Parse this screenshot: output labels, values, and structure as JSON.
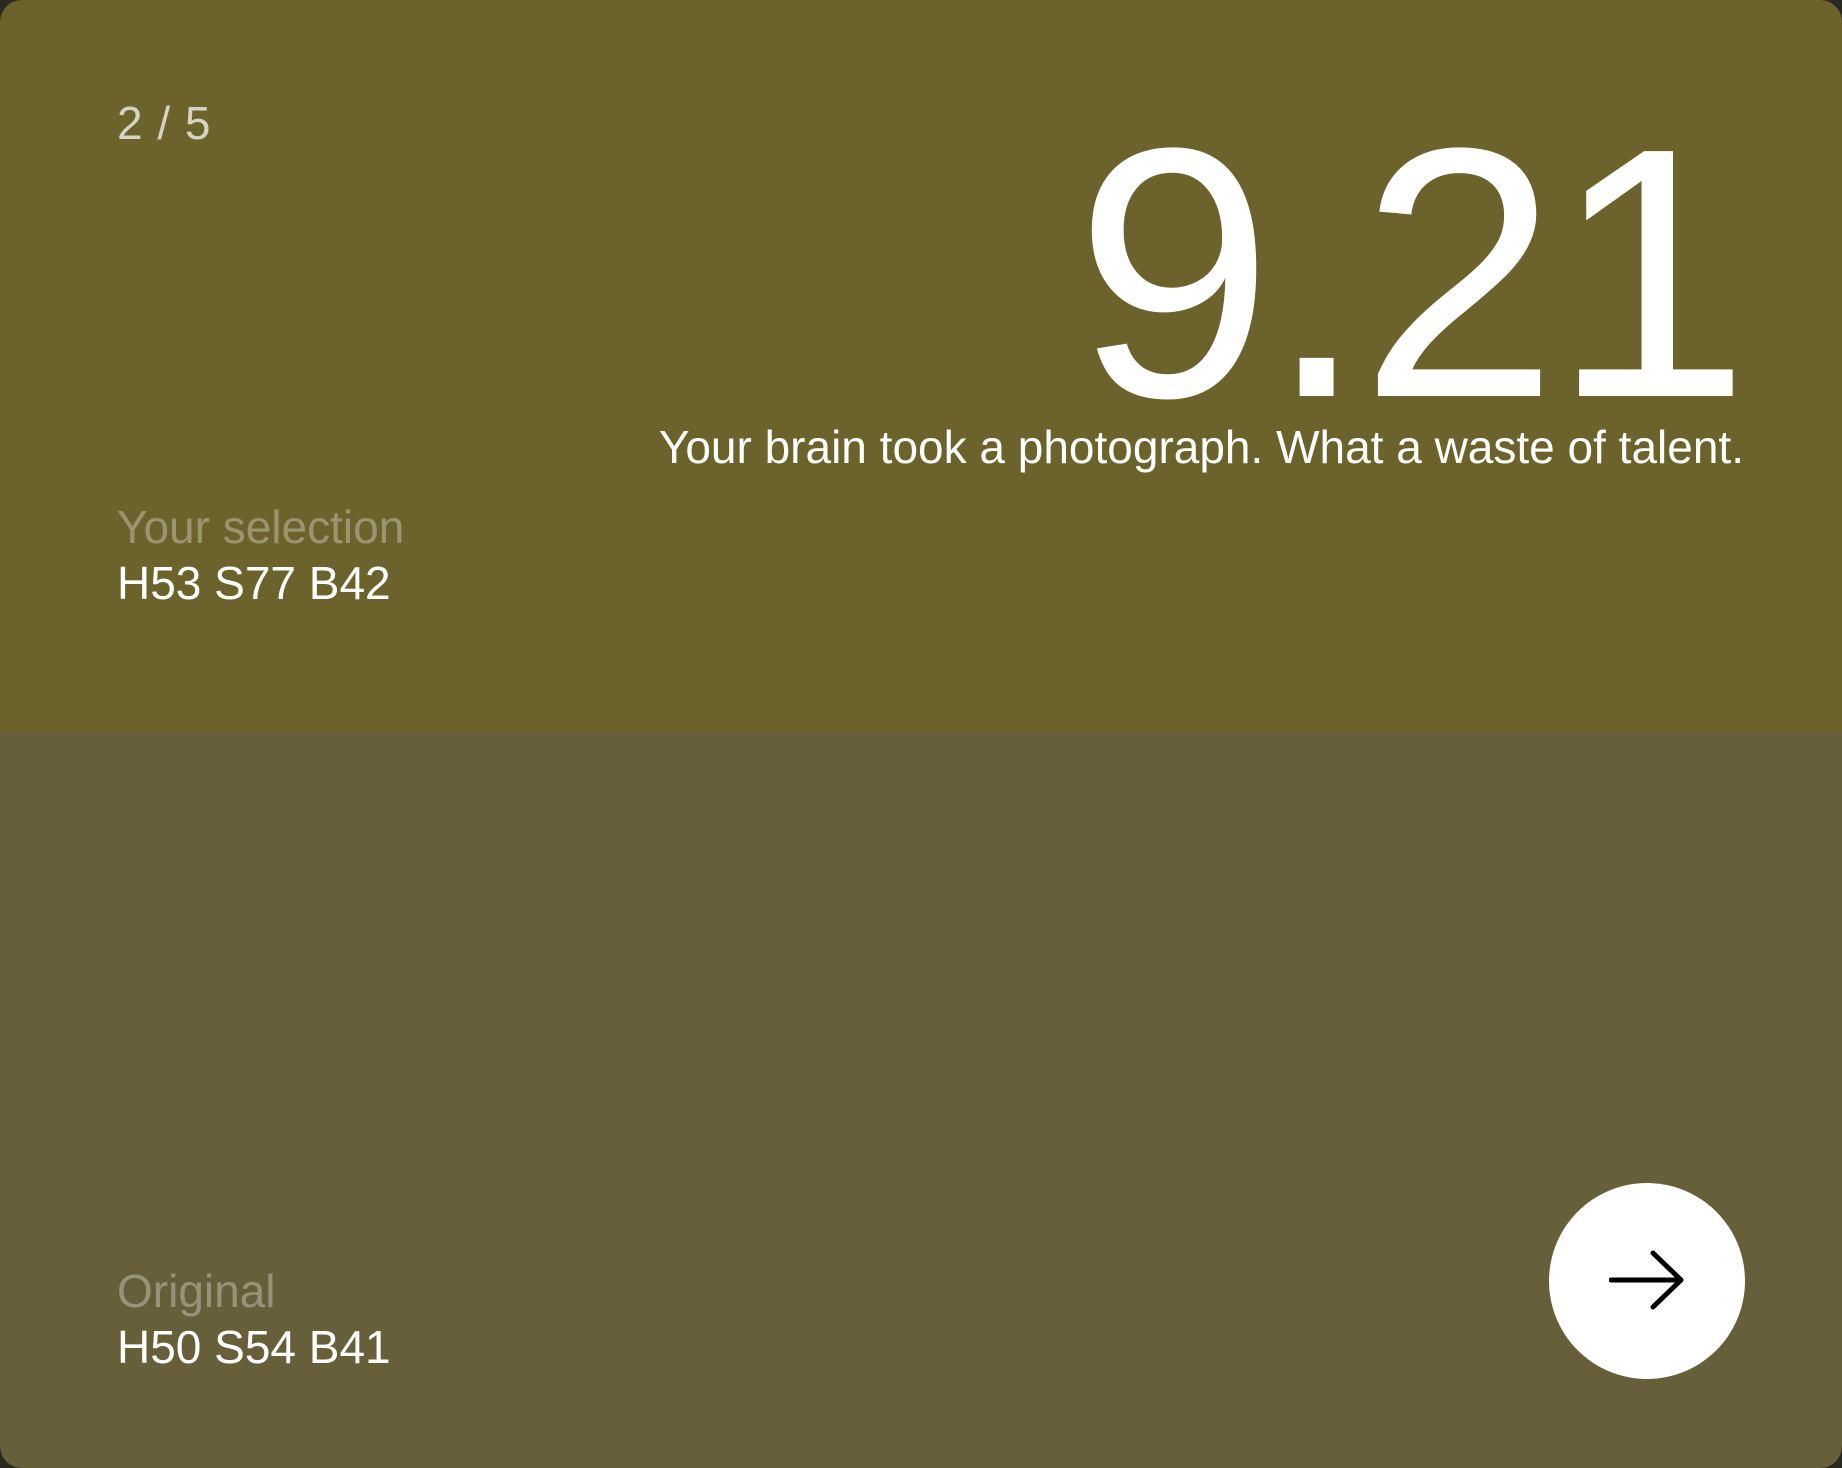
{
  "colors": {
    "selection_swatch": "#6b632b",
    "original_swatch": "#675f3a",
    "button_bg": "#ffffff",
    "button_icon": "#000000"
  },
  "progress": {
    "text": "2 / 5"
  },
  "result": {
    "score": "9.21",
    "message": "Your brain took a photograph. What a waste of talent."
  },
  "selection": {
    "label": "Your selection",
    "value": "H53 S77 B42"
  },
  "original": {
    "label": "Original",
    "value": "H50 S54 B41"
  },
  "next_button": {
    "icon": "arrow-right-icon"
  }
}
